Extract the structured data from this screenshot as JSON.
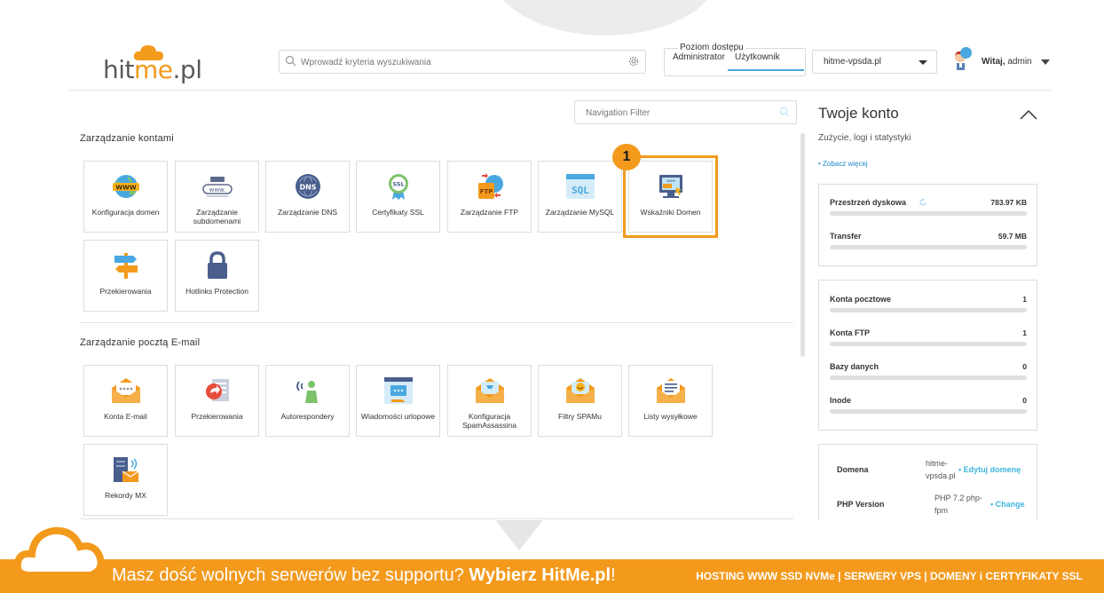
{
  "header": {
    "logo": {
      "prefix": "hit",
      "accent": "me",
      "suffix": ".pl"
    },
    "search_placeholder": "Wprowadź kryteria wyszukiwania",
    "access": {
      "title": "Poziom dostępu",
      "admin_label": "Administrator",
      "user_label": "Użytkownik"
    },
    "server_select": "hitme-vpsda.pl",
    "greeting_bold": "Witaj,",
    "greeting_user": "admin"
  },
  "nav_filter_placeholder": "Navigation Filter",
  "sections": {
    "accounts": {
      "title": "Zarządzanie kontami",
      "tiles": [
        {
          "label": "Konfiguracja domen",
          "icon": "www-globe-icon"
        },
        {
          "label": "Zarządzanie subdomenami",
          "icon": "subdomain-icon"
        },
        {
          "label": "Zarządzanie DNS",
          "icon": "dns-globe-icon"
        },
        {
          "label": "Certyfikaty SSL",
          "icon": "ssl-badge-icon"
        },
        {
          "label": "Zarządzanie FTP",
          "icon": "ftp-icon"
        },
        {
          "label": "Zarządzanie MySQL",
          "icon": "sql-icon"
        },
        {
          "label": "Wskaźniki Domen",
          "icon": "domain-pointer-icon"
        },
        {
          "label": "Przekierowania",
          "icon": "signpost-icon"
        },
        {
          "label": "Hotlinks Protection",
          "icon": "lock-icon"
        }
      ]
    },
    "email": {
      "title": "Zarządzanie pocztą E-mail",
      "tiles": [
        {
          "label": "Konta E-mail",
          "icon": "mail-account-icon"
        },
        {
          "label": "Przekierowania",
          "icon": "mail-forward-icon"
        },
        {
          "label": "Autorespondery",
          "icon": "autoresponder-icon"
        },
        {
          "label": "Wiadomości urlopowe",
          "icon": "vacation-message-icon"
        },
        {
          "label": "Konfiguracja SpamAssassina",
          "icon": "spamassassin-icon"
        },
        {
          "label": "Filtry SPAMu",
          "icon": "spam-filter-icon"
        },
        {
          "label": "Listy wysyłkowe",
          "icon": "mailing-list-icon"
        },
        {
          "label": "Rekordy MX",
          "icon": "mx-records-icon"
        }
      ]
    }
  },
  "step_badge": "1",
  "right_panel": {
    "title": "Twoje konto",
    "subtitle": "Zużycie, logi i statystyki",
    "more_link": "• Zobacz więcej",
    "usage": [
      {
        "label": "Przestrzeń dyskowa",
        "value": "783.97 KB"
      },
      {
        "label": "Transfer",
        "value": "59.7 MB"
      }
    ],
    "counts": [
      {
        "label": "Konta pocztowe",
        "value": "1"
      },
      {
        "label": "Konta FTP",
        "value": "1"
      },
      {
        "label": "Bazy danych",
        "value": "0"
      },
      {
        "label": "Inode",
        "value": "0"
      }
    ],
    "info": {
      "domain_label": "Domena",
      "domain_value": "hitme-vpsda.pl",
      "domain_link": "• Edytuj domenę",
      "php_label": "PHP Version",
      "php_value": "PHP 7.2 php-fpm",
      "php_link": "• Change"
    }
  },
  "banner": {
    "text": "Masz dość wolnych serwerów bez supportu?",
    "bold": "Wybierz HitMe.pl",
    "excl": "!",
    "right": "HOSTING WWW SSD NVMe | SERWERY VPS | DOMENY i CERTYFIKATY SSL"
  },
  "colors": {
    "accent": "#f39a1d",
    "link": "#3fb6e0",
    "tab_underline": "#4aa8e0"
  }
}
